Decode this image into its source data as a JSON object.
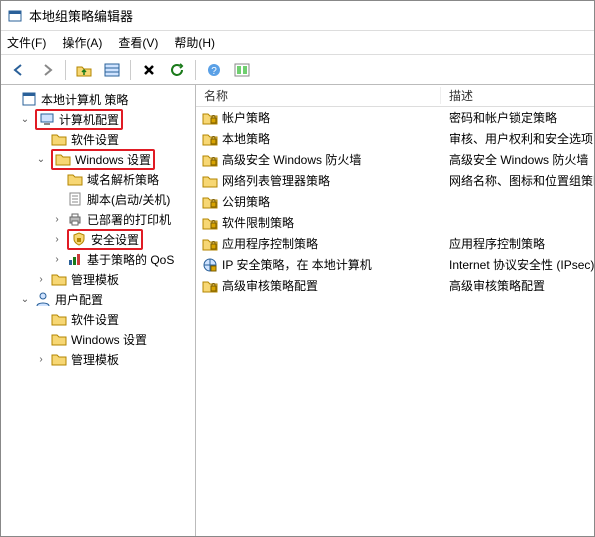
{
  "window": {
    "title": "本地组策略编辑器"
  },
  "menu": {
    "file": "文件(F)",
    "action": "操作(A)",
    "view": "查看(V)",
    "help": "帮助(H)"
  },
  "toolbar_icons": {
    "back": "back-icon",
    "forward": "forward-icon",
    "up": "up-folder-icon",
    "list": "list-view-icon",
    "delete": "delete-icon",
    "refresh": "refresh-icon",
    "help": "help-icon",
    "props": "properties-icon"
  },
  "tree": [
    {
      "indent": 0,
      "twisty": "",
      "icon": "policy",
      "label": "本地计算机 策略",
      "hl": false,
      "interact": true
    },
    {
      "indent": 1,
      "twisty": "v",
      "icon": "computer",
      "label": "计算机配置",
      "hl": true,
      "interact": true
    },
    {
      "indent": 2,
      "twisty": "",
      "icon": "folder",
      "label": "软件设置",
      "hl": false,
      "interact": true
    },
    {
      "indent": 2,
      "twisty": "v",
      "icon": "folder",
      "label": "Windows 设置",
      "hl": true,
      "interact": true
    },
    {
      "indent": 3,
      "twisty": "",
      "icon": "folder",
      "label": "域名解析策略",
      "hl": false,
      "interact": true
    },
    {
      "indent": 3,
      "twisty": "",
      "icon": "script",
      "label": "脚本(启动/关机)",
      "hl": false,
      "interact": true
    },
    {
      "indent": 3,
      "twisty": ">",
      "icon": "printer",
      "label": "已部署的打印机",
      "hl": false,
      "interact": true
    },
    {
      "indent": 3,
      "twisty": ">",
      "icon": "security",
      "label": "安全设置",
      "hl": true,
      "interact": true
    },
    {
      "indent": 3,
      "twisty": ">",
      "icon": "qos",
      "label": "基于策略的 QoS",
      "hl": false,
      "interact": true
    },
    {
      "indent": 2,
      "twisty": ">",
      "icon": "folder",
      "label": "管理模板",
      "hl": false,
      "interact": true
    },
    {
      "indent": 1,
      "twisty": "v",
      "icon": "user",
      "label": "用户配置",
      "hl": false,
      "interact": true
    },
    {
      "indent": 2,
      "twisty": "",
      "icon": "folder",
      "label": "软件设置",
      "hl": false,
      "interact": true
    },
    {
      "indent": 2,
      "twisty": "",
      "icon": "folder",
      "label": "Windows 设置",
      "hl": false,
      "interact": true
    },
    {
      "indent": 2,
      "twisty": ">",
      "icon": "folder",
      "label": "管理模板",
      "hl": false,
      "interact": true
    }
  ],
  "columns": {
    "name": "名称",
    "desc": "描述"
  },
  "rows": [
    {
      "icon": "folder-lock",
      "name": "帐户策略",
      "desc": "密码和帐户锁定策略"
    },
    {
      "icon": "folder-lock",
      "name": "本地策略",
      "desc": "审核、用户权利和安全选项"
    },
    {
      "icon": "folder-lock",
      "name": "高级安全 Windows 防火墙",
      "desc": "高级安全 Windows 防火墙"
    },
    {
      "icon": "folder",
      "name": "网络列表管理器策略",
      "desc": "网络名称、图标和位置组策略"
    },
    {
      "icon": "folder-lock",
      "name": "公钥策略",
      "desc": ""
    },
    {
      "icon": "folder-lock",
      "name": "软件限制策略",
      "desc": ""
    },
    {
      "icon": "folder-lock",
      "name": "应用程序控制策略",
      "desc": "应用程序控制策略"
    },
    {
      "icon": "ipsec",
      "name": "IP 安全策略，在 本地计算机",
      "desc": "Internet 协议安全性 (IPsec)"
    },
    {
      "icon": "folder-lock",
      "name": "高级审核策略配置",
      "desc": "高级审核策略配置"
    }
  ]
}
